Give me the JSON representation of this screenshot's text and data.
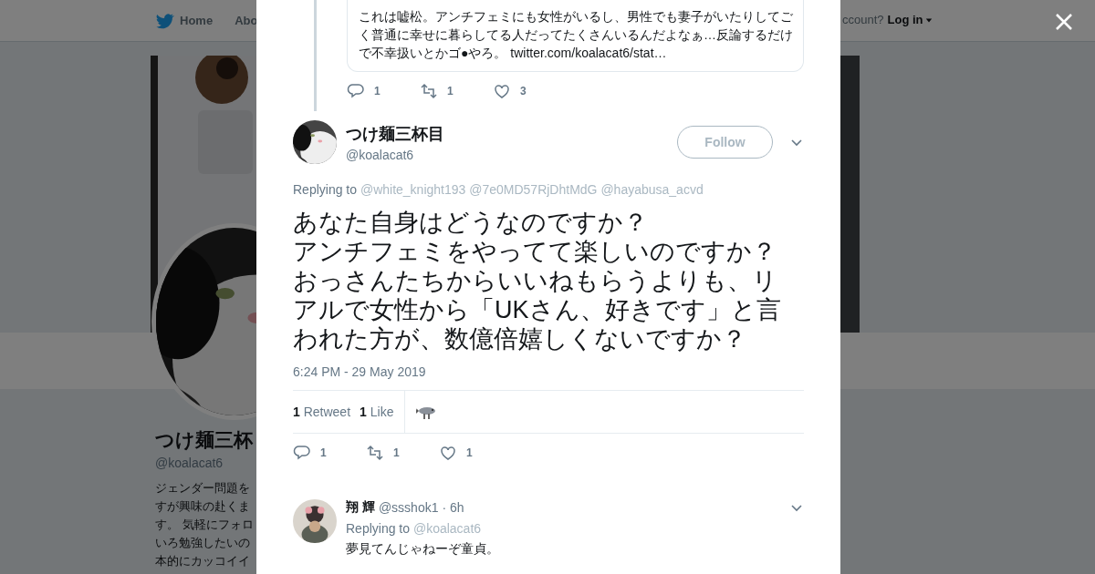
{
  "nav": {
    "items": [
      {
        "label": "Home"
      },
      {
        "label": "Abo"
      }
    ],
    "account_prompt": "ccount?",
    "login": "Log in"
  },
  "profile": {
    "name": "つけ麺三杯",
    "handle": "@koalacat6",
    "bio_lines": [
      "ジェンダー問題を",
      "すが興味の赴くま",
      "す。 気軽にフォロ",
      "いろ勉強したいの",
      "本的にカッコイイ"
    ]
  },
  "modal": {
    "quoted_tweet": {
      "text_lines": [
        "これは嘘松。アンチフェミにも女性がいるし、男性でも妻子がいたりしてご",
        "く普通に幸せに暮らしてる人だってたくさんいるんだよなぁ…反論するだけ",
        "で不幸扱いとかゴ●やろ。"
      ],
      "link": "twitter.com/koalacat6/stat…"
    },
    "parent_actions": {
      "replies": "1",
      "retweets": "1",
      "likes": "3"
    },
    "tweet": {
      "name": "つけ麺三杯目",
      "handle": "@koalacat6",
      "follow": "Follow",
      "replying_label": "Replying to",
      "reply_to": [
        "@white_knight193",
        "@7e0MD57RjDhtMdG",
        "@hayabusa_acvd"
      ],
      "text_lines": [
        "あなた自身はどうなのですか？",
        "アンチフェミをやってて楽しいのですか？",
        "おっさんたちからいいねもらうよりも、リ",
        "アルで女性から「UKさん、好きです」と言",
        "われた方が、数億倍嬉しくないですか？"
      ],
      "timestamp": "6:24 PM - 29 May 2019",
      "retweet_count": "1",
      "retweet_label": "Retweet",
      "like_count": "1",
      "like_label": "Like",
      "actions": {
        "replies": "1",
        "retweets": "1",
        "likes": "1"
      }
    },
    "replies": [
      {
        "name": "翔 輝",
        "handle": "@ssshok1",
        "time": "· 6h",
        "replying_label": "Replying to",
        "reply_to": [
          "@koalacat6"
        ],
        "text": "夢見てんじゃねーぞ童貞。"
      }
    ]
  }
}
